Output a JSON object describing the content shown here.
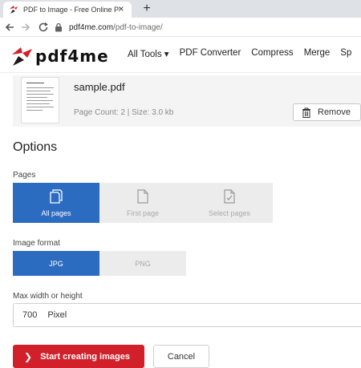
{
  "browser": {
    "tab_title": "PDF to Image - Free Online PDF t",
    "close_glyph": "×",
    "newtab_glyph": "+",
    "url_host": "pdf4me.com",
    "url_path": "/pdf-to-image/",
    "icons": [
      "favicon-icon",
      "back-icon",
      "forward-icon",
      "reload-icon",
      "lock-icon"
    ]
  },
  "site": {
    "logo_text": "pdf4me",
    "nav": [
      "All Tools ▾",
      "PDF Converter",
      "Compress",
      "Merge",
      "Sp"
    ],
    "brand_color": "#d2202a"
  },
  "file": {
    "name": "sample.pdf",
    "meta": "Page Count: 2  |  Size: 3.0 kb",
    "remove_label": "Remove"
  },
  "options": {
    "title": "Options",
    "pages_label": "Pages",
    "pages": [
      {
        "label": "All pages",
        "icon": "copy-pages-icon",
        "active": true
      },
      {
        "label": "First page",
        "icon": "page-icon",
        "active": false
      },
      {
        "label": "Select pages",
        "icon": "check-page-icon",
        "active": false
      }
    ],
    "format_label": "Image format",
    "formats": [
      {
        "label": "JPG",
        "active": true
      },
      {
        "label": "PNG",
        "active": false
      }
    ],
    "size_label": "Max width or height",
    "size_value": "700",
    "size_unit": "Pixel",
    "accent_color": "#2c6cc0"
  },
  "actions": {
    "start_label": "Start creating images",
    "cancel_label": "Cancel"
  }
}
